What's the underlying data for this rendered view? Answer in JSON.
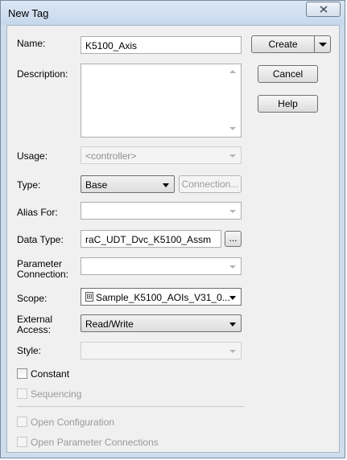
{
  "window": {
    "title": "New Tag"
  },
  "form": {
    "name": {
      "label": "Name:",
      "value": "K5100_Axis"
    },
    "description": {
      "label": "Description:",
      "value": ""
    },
    "usage": {
      "label": "Usage:",
      "value": "<controller>"
    },
    "type": {
      "label": "Type:",
      "value": "Base",
      "connection_button": "Connection..."
    },
    "alias_for": {
      "label": "Alias For:",
      "value": ""
    },
    "data_type": {
      "label": "Data Type:",
      "value": "raC_UDT_Dvc_K5100_Assm",
      "browse_button": "..."
    },
    "parameter_connection": {
      "label_line1": "Parameter",
      "label_line2": "Connection:",
      "value": ""
    },
    "scope": {
      "label": "Scope:",
      "value": "Sample_K5100_AOIs_V31_0..."
    },
    "external_access": {
      "label_line1": "External",
      "label_line2": "Access:",
      "value": "Read/Write"
    },
    "style": {
      "label": "Style:",
      "value": ""
    }
  },
  "checkboxes": {
    "constant": {
      "label": "Constant",
      "checked": false,
      "enabled": true
    },
    "sequencing": {
      "label": "Sequencing",
      "checked": false,
      "enabled": false
    },
    "open_configuration": {
      "label": "Open Configuration",
      "checked": false,
      "enabled": false
    },
    "open_parameter_connections": {
      "label": "Open Parameter Connections",
      "checked": false,
      "enabled": false
    }
  },
  "buttons": {
    "create": "Create",
    "cancel": "Cancel",
    "help": "Help"
  },
  "icons": {
    "close": "close-icon",
    "dropdown": "chevron-down-icon",
    "scope_program": "program-scope-icon"
  },
  "colors": {
    "title_bar": "#c6d7ec",
    "client_bg": "#f0f0f0",
    "disabled_text": "#9a9a9a"
  }
}
